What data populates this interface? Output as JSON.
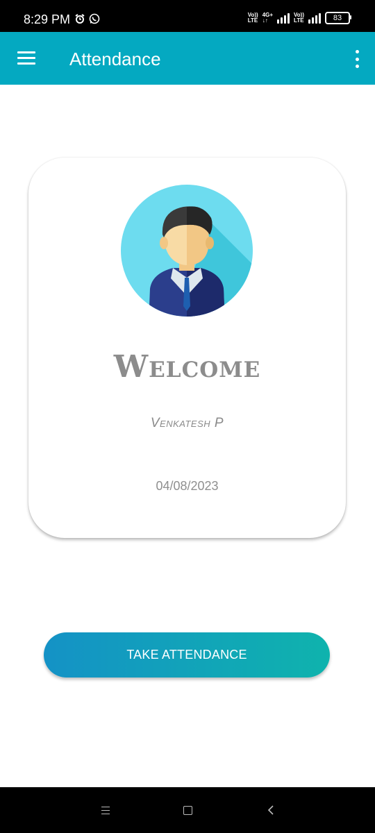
{
  "status_bar": {
    "time": "8:29 PM",
    "icons": [
      "alarm-icon",
      "whatsapp-icon"
    ],
    "sim1_label_top": "Vo))",
    "sim1_label_bottom": "LTE",
    "network_label_top": "4G+",
    "network_label_bottom": "↓↑",
    "sim2_label_top": "Vo))",
    "sim2_label_bottom": "LTE",
    "battery": "83"
  },
  "app_bar": {
    "title": "Attendance",
    "menu_icon": "hamburger-menu-icon",
    "overflow_icon": "more-vert-icon",
    "color": "#04a9c1"
  },
  "card": {
    "avatar_icon": "user-avatar-icon",
    "welcome": "Welcome",
    "user_name": "Venkatesh P",
    "date": "04/08/2023"
  },
  "actions": {
    "take_attendance_label": "TAKE ATTENDANCE",
    "gradient_start": "#1492c6",
    "gradient_end": "#0fb3ad"
  },
  "nav_bar": {
    "icons": [
      "recents-icon",
      "home-icon",
      "back-icon"
    ]
  }
}
